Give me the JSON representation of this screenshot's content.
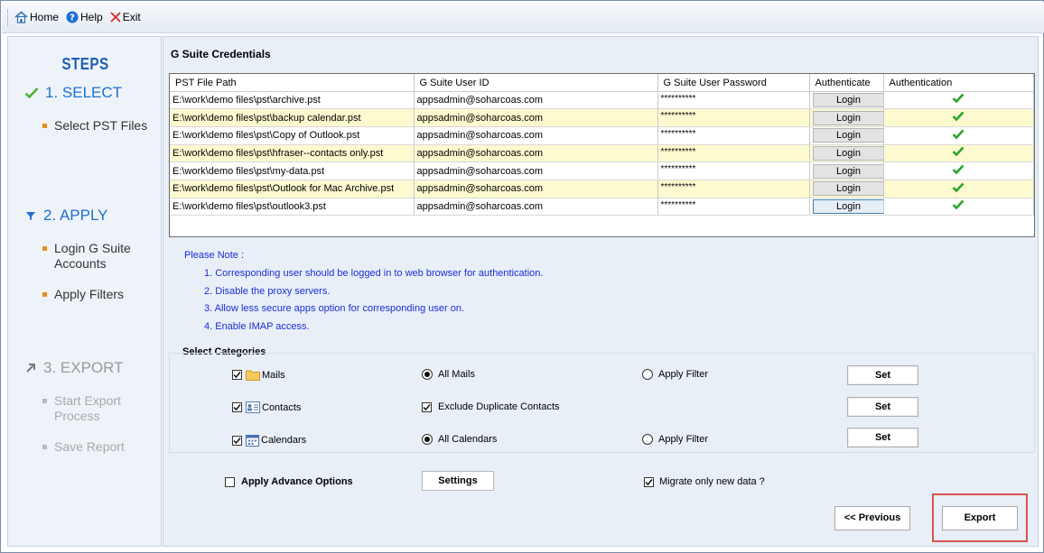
{
  "menubar": {
    "home_label": "Home",
    "help_label": "Help",
    "exit_label": "Exit"
  },
  "sidebar": {
    "title": "STEPS",
    "step1": {
      "label": "1. SELECT",
      "items": [
        "Select PST Files"
      ]
    },
    "step2": {
      "label": "2. APPLY",
      "items": [
        "Login G Suite Accounts",
        "Apply Filters"
      ]
    },
    "step3": {
      "label": "3. EXPORT",
      "items": [
        "Start Export Process",
        "Save Report"
      ]
    }
  },
  "credentials": {
    "title": "G Suite Credentials",
    "columns": [
      "PST File Path",
      "G Suite User ID",
      "G Suite User Password",
      "Authenticate",
      "Authentication"
    ],
    "rows": [
      {
        "path": "E:\\work\\demo files\\pst\\archive.pst",
        "user": "appsadmin@soharcoas.com",
        "password": "**********",
        "button": "Login"
      },
      {
        "path": "E:\\work\\demo files\\pst\\backup calendar.pst",
        "user": "appsadmin@soharcoas.com",
        "password": "**********",
        "button": "Login"
      },
      {
        "path": "E:\\work\\demo files\\pst\\Copy of Outlook.pst",
        "user": "appsadmin@soharcoas.com",
        "password": "**********",
        "button": "Login"
      },
      {
        "path": "E:\\work\\demo files\\pst\\hfraser--contacts only.pst",
        "user": "appsadmin@soharcoas.com",
        "password": "**********",
        "button": "Login"
      },
      {
        "path": "E:\\work\\demo files\\pst\\my-data.pst",
        "user": "appsadmin@soharcoas.com",
        "password": "**********",
        "button": "Login"
      },
      {
        "path": "E:\\work\\demo files\\pst\\Outlook for Mac Archive.pst",
        "user": "appsadmin@soharcoas.com",
        "password": "**********",
        "button": "Login"
      },
      {
        "path": "E:\\work\\demo files\\pst\\outlook3.pst",
        "user": "appsadmin@soharcoas.com",
        "password": "**********",
        "button": "Login"
      }
    ]
  },
  "note": {
    "title": "Please Note :",
    "items": [
      "1. Corresponding user should be logged in to web browser for authentication.",
      "2. Disable the proxy servers.",
      "3. Allow less secure apps option for corresponding user on.",
      "4. Enable IMAP access."
    ]
  },
  "categories": {
    "title": "Select Categories",
    "mails": {
      "label": "Mails",
      "option1": "All Mails",
      "option2": "Apply Filter",
      "set": "Set"
    },
    "contacts": {
      "label": "Contacts",
      "option1": "Exclude Duplicate Contacts",
      "set": "Set"
    },
    "calendars": {
      "label": "Calendars",
      "option1": "All Calendars",
      "option2": "Apply Filter",
      "set": "Set"
    }
  },
  "advanced": {
    "label": "Apply Advance Options",
    "settings": "Settings",
    "migrate_label": "Migrate only new data ?"
  },
  "footer": {
    "previous": "<< Previous",
    "export": "Export"
  },
  "colors": {
    "accent": "#1e6fd0",
    "note_text": "#1c2ed6",
    "alt_row": "#fdfad0",
    "check_green": "#2aa52a",
    "highlight": "#d9534f"
  }
}
